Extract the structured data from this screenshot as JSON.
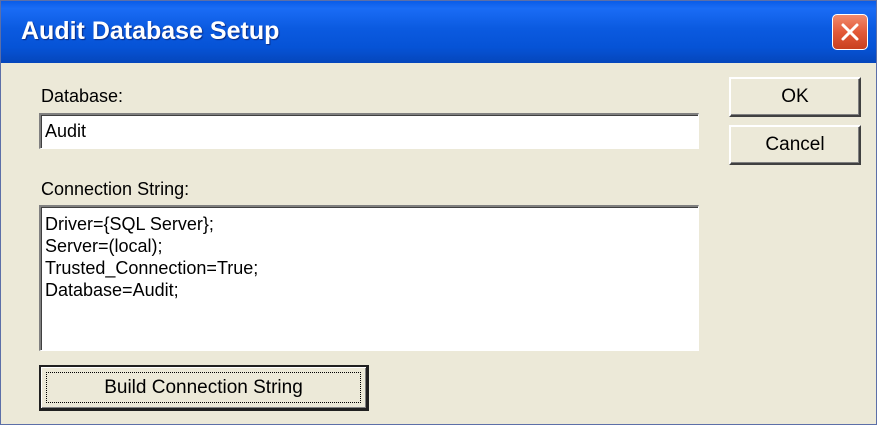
{
  "window": {
    "title": "Audit Database Setup",
    "close_icon": "close-icon"
  },
  "form": {
    "database_label": "Database:",
    "database_value": "Audit",
    "connection_label": "Connection String:",
    "connection_lines": [
      "Driver={SQL Server};",
      "Server=(local);",
      "Trusted_Connection=True;",
      "Database=Audit;"
    ]
  },
  "buttons": {
    "ok": "OK",
    "cancel": "Cancel",
    "build": "Build Connection String"
  },
  "colors": {
    "titlebar": "#0653d6",
    "dialog_bg": "#ece9d8",
    "close_button": "#e35a39"
  }
}
